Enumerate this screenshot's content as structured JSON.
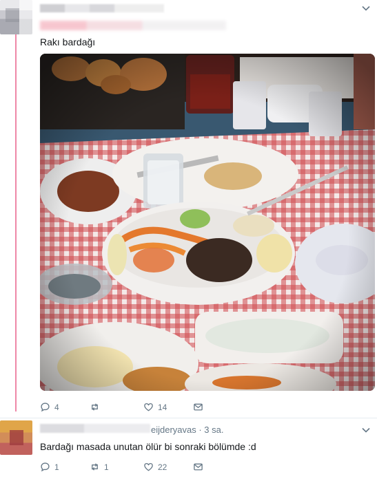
{
  "tweet": {
    "text": "Rakı bardağı",
    "actions": {
      "replies": "4",
      "retweets": "",
      "likes": "14"
    }
  },
  "reply": {
    "handle": "eijderyavas · 3 sa.",
    "text": "Bardağı masada unutan ölür bi sonraki bölümde :d",
    "actions": {
      "replies": "1",
      "retweets": "1",
      "likes": "22"
    }
  },
  "icons": {
    "menu": "chevron-down-icon",
    "reply": "reply-icon",
    "retweet": "retweet-icon",
    "like": "heart-icon",
    "dm": "envelope-icon"
  },
  "colors": {
    "thread_line": "#e0245e",
    "icon_gray": "#657786",
    "text": "#14171a"
  }
}
